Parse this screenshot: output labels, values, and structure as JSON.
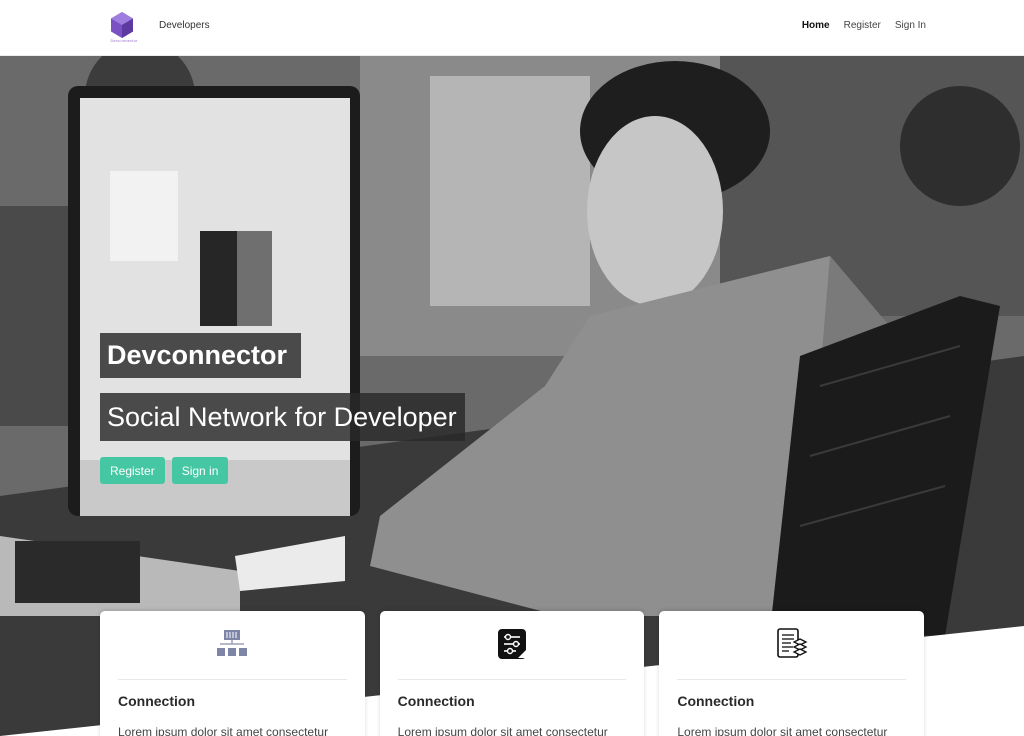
{
  "navbar": {
    "logo_text": "Devconnector",
    "developers_label": "Developers",
    "links": [
      "Home",
      "Register",
      "Sign In"
    ]
  },
  "hero": {
    "title": "Devconnector",
    "subtitle": "Social Network for Developer",
    "register_label": "Register",
    "signin_label": "Sign in"
  },
  "cards": [
    {
      "icon": "network-hierarchy-icon",
      "title": "Connection",
      "text": "Lorem ipsum dolor sit amet consectetur"
    },
    {
      "icon": "settings-sliders-icon",
      "title": "Connection",
      "text": "Lorem ipsum dolor sit amet consectetur"
    },
    {
      "icon": "documents-stack-icon",
      "title": "Connection",
      "text": "Lorem ipsum dolor sit amet consectetur"
    }
  ],
  "colors": {
    "accent": "#46c7a3",
    "logo": "#7b52c4"
  }
}
